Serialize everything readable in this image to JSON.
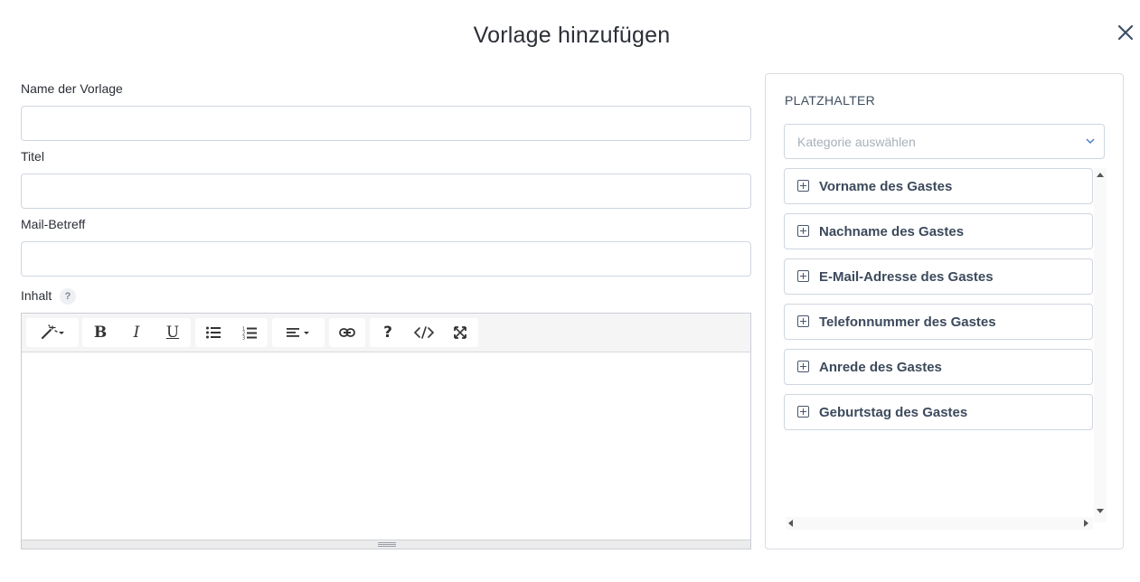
{
  "dialog": {
    "title": "Vorlage hinzufügen"
  },
  "form": {
    "name_label": "Name der Vorlage",
    "name_value": "",
    "title_label": "Titel",
    "title_value": "",
    "subject_label": "Mail-Betreff",
    "subject_value": "",
    "content_label": "Inhalt",
    "content_help": "?"
  },
  "editor": {
    "toolbar": {
      "bold": "B",
      "italic": "I",
      "underline": "U",
      "help": "?"
    }
  },
  "placeholders": {
    "heading": "PLATZHALTER",
    "category_placeholder": "Kategorie auswählen",
    "items": [
      {
        "label": "Vorname des Gastes"
      },
      {
        "label": "Nachname des Gastes"
      },
      {
        "label": "E-Mail-Adresse des Gastes"
      },
      {
        "label": "Telefonnummer des Gastes"
      },
      {
        "label": "Anrede des Gastes"
      },
      {
        "label": "Geburtstag des Gastes"
      }
    ]
  },
  "colors": {
    "text": "#2b2f36",
    "border": "#cfd6df",
    "accent": "#4a7fc1"
  }
}
